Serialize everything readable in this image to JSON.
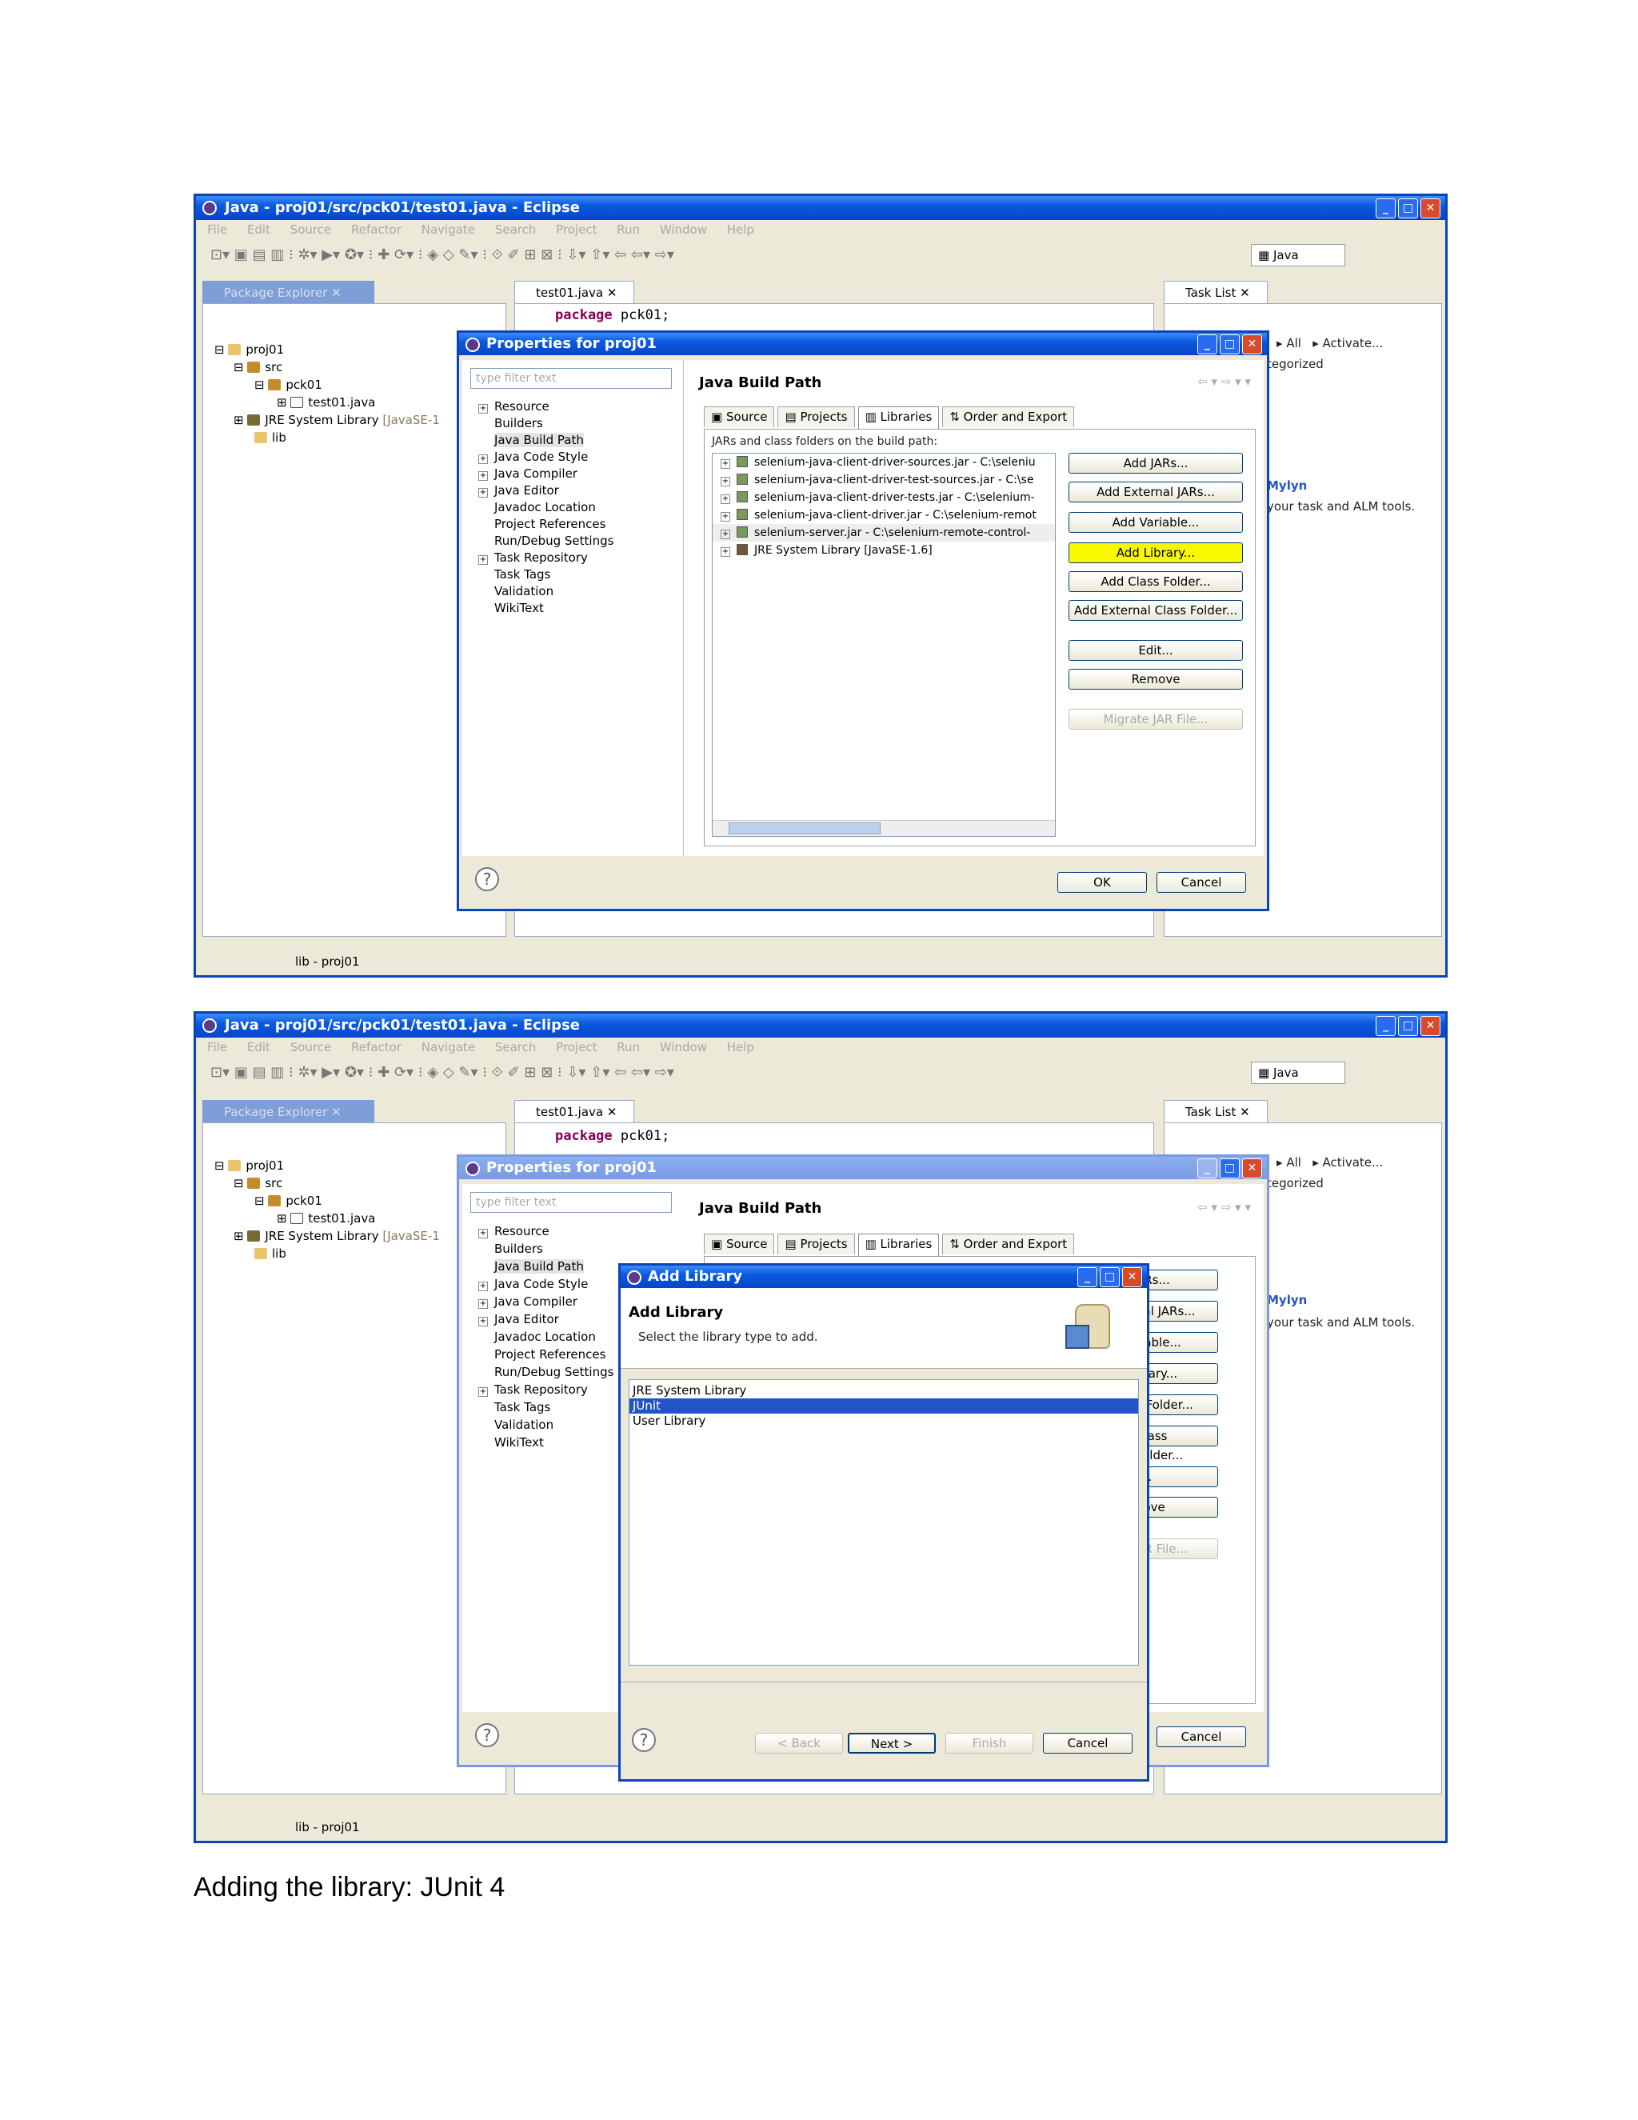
{
  "window": {
    "title": "Java - proj01/src/pck01/test01.java - Eclipse",
    "menus": [
      "File",
      "Edit",
      "Source",
      "Refactor",
      "Navigate",
      "Search",
      "Project",
      "Run",
      "Window",
      "Help"
    ],
    "perspective": "Java",
    "status_text": "lib - proj01"
  },
  "package_explorer": {
    "tab": "Package Explorer",
    "tree": [
      {
        "label": "proj01"
      },
      {
        "label": "src"
      },
      {
        "label": "pck01"
      },
      {
        "label": "test01.java"
      },
      {
        "label": "JRE System Library",
        "suffix": "[JavaSE-1"
      },
      {
        "label": "lib"
      }
    ]
  },
  "editor": {
    "tab": "test01.java",
    "code_keyword": "package",
    "code_rest": "pck01;"
  },
  "task_list": {
    "tab": "Task List",
    "all": "All",
    "activate": "Activate...",
    "categorized": "tegorized",
    "mylyn": "Mylyn",
    "mylyn_text": "your task and ALM tools."
  },
  "properties_dialog": {
    "title": "Properties for proj01",
    "filter_placeholder": "type filter text",
    "heading": "Java Build Path",
    "nav": [
      {
        "label": "Resource",
        "expand": true
      },
      {
        "label": "Builders",
        "expand": false
      },
      {
        "label": "Java Build Path",
        "expand": false,
        "selected": true
      },
      {
        "label": "Java Code Style",
        "expand": true
      },
      {
        "label": "Java Compiler",
        "expand": true
      },
      {
        "label": "Java Editor",
        "expand": true
      },
      {
        "label": "Javadoc Location",
        "expand": false
      },
      {
        "label": "Project References",
        "expand": false
      },
      {
        "label": "Run/Debug Settings",
        "expand": false
      },
      {
        "label": "Task Repository",
        "expand": true
      },
      {
        "label": "Task Tags",
        "expand": false
      },
      {
        "label": "Validation",
        "expand": false
      },
      {
        "label": "WikiText",
        "expand": false
      }
    ],
    "tabs": [
      "Source",
      "Projects",
      "Libraries",
      "Order and Export"
    ],
    "active_tab": "Libraries",
    "list_label": "JARs and class folders on the build path:",
    "jars": [
      "selenium-java-client-driver-sources.jar - C:\\seleniu",
      "selenium-java-client-driver-test-sources.jar - C:\\se",
      "selenium-java-client-driver-tests.jar - C:\\selenium-",
      "selenium-java-client-driver.jar - C:\\selenium-remot",
      "selenium-server.jar - C:\\selenium-remote-control-",
      "JRE System Library [JavaSE-1.6]"
    ],
    "buttons": [
      "Add JARs...",
      "Add External JARs...",
      "Add Variable...",
      "Add Library...",
      "Add Class Folder...",
      "Add External Class Folder...",
      "Edit...",
      "Remove",
      "Migrate JAR File..."
    ],
    "ok": "OK",
    "cancel": "Cancel"
  },
  "add_library_dialog": {
    "title": "Add Library",
    "heading": "Add Library",
    "subtext": "Select the library type to add.",
    "types": [
      "JRE System Library",
      "JUnit",
      "User Library"
    ],
    "selected": "JUnit",
    "back": "< Back",
    "next": "Next >",
    "finish": "Finish",
    "cancel": "Cancel",
    "partial_buttons": [
      "ARs...",
      "nal JARs...",
      "riable...",
      "brary...",
      "s Folder...",
      "Class Folder...",
      "t...",
      "nove",
      "AR File..."
    ]
  },
  "caption": "Adding the library: JUnit 4",
  "colors": {
    "highlight": "#f8f800",
    "selection": "#2254c8",
    "titlebar": "#0a5ae0"
  }
}
